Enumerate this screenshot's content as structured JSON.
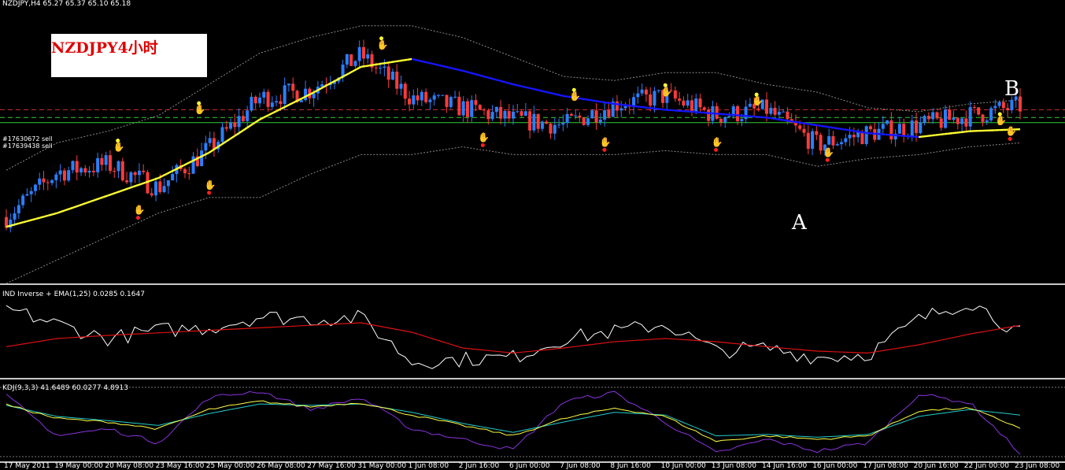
{
  "colors": {
    "background": "#000000",
    "bull": "#2a7fff",
    "bear": "#ff3b3b",
    "ma_up": "#ffff33",
    "ma_down": "#1515ff",
    "band": "#8a8a8a",
    "order_line": "#d03030",
    "green_line": "#33cc33",
    "ind_line": "#ffffff",
    "ema_line": "#dd1111",
    "k_line": "#ffff44",
    "d_line": "#22cccc",
    "j_line": "#8833dd"
  },
  "main_panel": {
    "symbol_info": "NZDJPY,H4  65.27 65.37 65.10 65.18",
    "title_box": "NZDJPY4小时",
    "order_1": "#17630672 sell",
    "order_2": "#17639438 sell",
    "point_a": "A",
    "point_b": "B"
  },
  "ind_panel": {
    "label": "IND Inverse + EMA(1,25) 0.0285 0.1647"
  },
  "kdj_panel": {
    "label": "KDJ(9,3,3) 41.6489 60.0277 4.8913"
  },
  "time_axis": [
    "17 May 2011",
    "19 May 00:00",
    "20 May 08:00",
    "23 May 16:00",
    "25 May 00:00",
    "26 May 08:00",
    "27 May 16:00",
    "31 May 00:00",
    "1 Jun 08:00",
    "2 Jun 16:00",
    "6 Jun 00:00",
    "7 Jun 08:00",
    "8 Jun 16:00",
    "10 Jun 00:00",
    "13 Jun 08:00",
    "14 Jun 16:00",
    "16 Jun 00:00",
    "17 Jun 08:00",
    "20 Jun 16:00",
    "22 Jun 00:00",
    "23 Jun 08:00"
  ],
  "chart_data": {
    "type": "candlestick",
    "symbol": "NZDJPY",
    "timeframe": "H4",
    "x": [
      "17 May 2011",
      "19 May 00:00",
      "20 May 08:00",
      "23 May 16:00",
      "25 May 00:00",
      "26 May 08:00",
      "27 May 16:00",
      "31 May 00:00",
      "1 Jun 08:00",
      "2 Jun 16:00",
      "6 Jun 00:00",
      "7 Jun 08:00",
      "8 Jun 16:00",
      "10 Jun 00:00",
      "13 Jun 08:00",
      "14 Jun 16:00",
      "16 Jun 00:00",
      "17 Jun 08:00",
      "20 Jun 16:00",
      "22 Jun 00:00",
      "23 Jun 08:00"
    ],
    "close": [
      62.7,
      63.85,
      64.05,
      63.45,
      64.45,
      65.75,
      65.95,
      66.85,
      65.75,
      65.5,
      65.2,
      65.05,
      65.6,
      65.8,
      65.3,
      65.45,
      64.55,
      64.85,
      65.05,
      65.3,
      65.55
    ],
    "ma": [
      62.45,
      62.8,
      63.25,
      63.7,
      64.35,
      65.2,
      65.85,
      66.55,
      66.75,
      66.45,
      66.1,
      65.8,
      65.6,
      65.45,
      65.35,
      65.25,
      65.05,
      64.85,
      64.75,
      64.9,
      64.95
    ],
    "upper_band": [
      63.9,
      64.6,
      64.9,
      65.3,
      66.1,
      66.9,
      67.3,
      67.6,
      67.6,
      67.3,
      66.8,
      66.3,
      66.2,
      66.4,
      66.4,
      66.1,
      65.9,
      65.5,
      65.4,
      65.6,
      65.7
    ],
    "lower_band": [
      61.0,
      61.6,
      62.2,
      62.8,
      63.2,
      63.2,
      63.8,
      64.3,
      64.3,
      64.5,
      64.3,
      64.3,
      64.3,
      64.4,
      64.3,
      64.3,
      64.0,
      64.2,
      64.3,
      64.5,
      64.6
    ],
    "levels": [
      {
        "name": "#17630672 sell",
        "value": 65.45
      },
      {
        "name": "#17639438 sell",
        "value": 65.25
      }
    ],
    "annotations": [
      {
        "text": "A",
        "x": "16 Jun 00:00"
      },
      {
        "text": "B",
        "x": "23 Jun 08:00"
      }
    ],
    "indicators": [
      {
        "name": "IND Inverse",
        "values": [
          0.42,
          0.18,
          -0.05,
          0.08,
          0.12,
          0.3,
          0.26,
          0.28,
          -0.42,
          -0.38,
          -0.35,
          -0.05,
          0.06,
          0.18,
          -0.25,
          -0.2,
          -0.35,
          -0.3,
          0.25,
          0.55,
          0.03
        ]
      },
      {
        "name": "EMA(1,25)",
        "values": [
          -0.18,
          -0.05,
          0.0,
          0.04,
          0.08,
          0.12,
          0.16,
          0.2,
          0.05,
          -0.2,
          -0.28,
          -0.2,
          -0.1,
          -0.05,
          -0.1,
          -0.18,
          -0.25,
          -0.28,
          -0.15,
          0.02,
          0.16
        ]
      },
      {
        "name": "KDJ K",
        "values": [
          75,
          55,
          50,
          40,
          68,
          80,
          72,
          78,
          60,
          45,
          30,
          55,
          70,
          58,
          22,
          30,
          25,
          30,
          66,
          70,
          41.6489
        ]
      },
      {
        "name": "KDJ D",
        "values": [
          74,
          58,
          52,
          45,
          62,
          76,
          74,
          76,
          64,
          48,
          35,
          50,
          64,
          60,
          30,
          32,
          28,
          32,
          58,
          68,
          60.0277
        ]
      },
      {
        "name": "KDJ J",
        "values": [
          88,
          30,
          40,
          20,
          85,
          95,
          68,
          85,
          40,
          25,
          10,
          80,
          92,
          50,
          5,
          25,
          8,
          20,
          90,
          78,
          4.8913
        ]
      }
    ]
  }
}
